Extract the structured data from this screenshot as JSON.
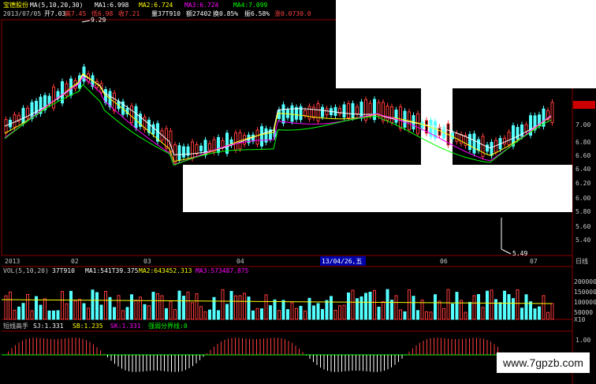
{
  "header": {
    "name": "宝德股份",
    "ma_label": "MA(5,10,20,30)",
    "ma1": "MA1:6.998",
    "ma2": "MA2:6.724",
    "ma3": "MA3:6.724",
    "ma4": "MA4:7.099"
  },
  "info": {
    "date": "2013/07/05",
    "open": "开7.03",
    "high": "高7.45",
    "low": "低6.98",
    "close": "收7.21",
    "volume": "量37T910",
    "amount": "额27402",
    "turnover": "换0.85%",
    "amplitude": "振6.58%",
    "change": "涨0.0730.0"
  },
  "price_axis": [
    "7.21",
    "7.00",
    "6.80",
    "6.60",
    "6.40",
    "6.20",
    "6.00",
    "5.80",
    "5.60",
    "5.40"
  ],
  "time_axis": [
    "2013",
    "02",
    "03",
    "04",
    "05",
    "06",
    "07"
  ],
  "cursor_date": "13/04/26,五",
  "period_label": "日线",
  "price_marks": {
    "high": "9.29",
    "low": "5.49"
  },
  "volume": {
    "label": "VOL(5,10,20)",
    "v1": "37T910",
    "ma1": "MA1:541T39.375",
    "ma2": "MA2:643452.313",
    "ma3": "MA3:573487.875",
    "axis": [
      "200000",
      "150000",
      "100000",
      "50000",
      "X10"
    ]
  },
  "indicator": {
    "name": "短线高手",
    "sj": "SJ:1.331",
    "sb": "SB:1.235",
    "sk": "SK:1.331",
    "line": "强弱分界线:0",
    "axis": [
      "1.00"
    ]
  },
  "watermark": "www.7gpzb.com",
  "colors": {
    "up": "#ff3b3b",
    "down": "#54ffff",
    "ma1": "#ffffff",
    "ma2": "#ffff00",
    "ma3": "#ff00ff",
    "ma4": "#00ff00",
    "grid": "#8b0000"
  }
}
